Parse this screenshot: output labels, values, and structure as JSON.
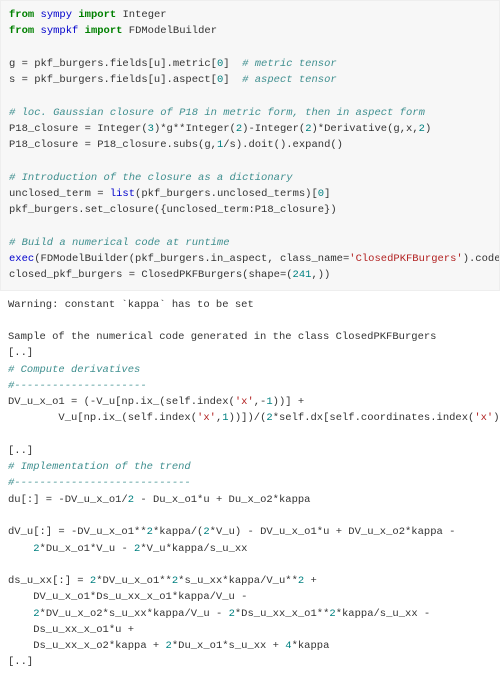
{
  "code": {
    "l01a": "from",
    "l01b": "sympy",
    "l01c": "import",
    "l01d": "Integer",
    "l02a": "from",
    "l02b": "sympkf",
    "l02c": "import",
    "l02d": "FDModelBuilder",
    "l03": "",
    "l04a": "g = pkf_burgers.fields[u].metric[",
    "l04n": "0",
    "l04b": "]  ",
    "l04c": "# metric tensor",
    "l05a": "s = pkf_burgers.fields[u].aspect[",
    "l05n": "0",
    "l05b": "]  ",
    "l05c": "# aspect tensor",
    "l06": "",
    "l07": "# loc. Gaussian closure of P18 in metric form, then in aspect form",
    "l08a": "P18_closure = Integer(",
    "l08n1": "3",
    "l08b": ")*g**Integer(",
    "l08n2": "2",
    "l08c": ")-Integer(",
    "l08n3": "2",
    "l08d": ")*Derivative(g,x,",
    "l08n4": "2",
    "l08e": ")",
    "l09a": "P18_closure = P18_closure.subs(g,",
    "l09n": "1",
    "l09b": "/s).doit().expand()",
    "l10": "",
    "l11": "# Introduction of the closure as a dictionary",
    "l12a": "unclosed_term = ",
    "l12b": "list",
    "l12c": "(pkf_burgers.unclosed_terms)[",
    "l12n": "0",
    "l12d": "]",
    "l13": "pkf_burgers.set_closure({unclosed_term:P18_closure})",
    "l14": "",
    "l15": "# Build a numerical code at runtime",
    "l16a": "exec",
    "l16b": "(FDModelBuilder(pkf_burgers.in_aspect, class_name=",
    "l16s": "'ClosedPKFBurgers'",
    "l16c": ").code)",
    "l17a": "closed_pkf_burgers = ClosedPKFBurgers(shape=(",
    "l17n": "241",
    "l17b": ",))"
  },
  "out": {
    "o01": "Warning: constant `kappa` has to be set",
    "o02": "",
    "o03": "Sample of the numerical code generated in the class ClosedPKFBurgers",
    "o04": "[..]",
    "o05": "# Compute derivatives",
    "o06": "#---------------------",
    "o07a": "DV_u_x_o1 = (-V_u[np.ix_(self.index(",
    "o07s1": "'x'",
    "o07b": ",-",
    "o07n1": "1",
    "o07c": "))] +",
    "o08a": "        V_u[np.ix_(self.index(",
    "o08s": "'x'",
    "o08b": ",",
    "o08n1": "1",
    "o08c": "))])/(",
    "o08n2": "2",
    "o08d": "*self.dx[self.coordinates.index(",
    "o08s2": "'x'",
    "o08e": ")])",
    "o09": "",
    "o10": "[..]",
    "o11": "# Implementation of the trend",
    "o12": "#----------------------------",
    "o13a": "du[:] = -DV_u_x_o1/",
    "o13n": "2",
    "o13b": " - Du_x_o1*u + Du_x_o2*kappa",
    "o14": "",
    "o15a": "dV_u[:] = -DV_u_x_o1**",
    "o15n1": "2",
    "o15b": "*kappa/(",
    "o15n2": "2",
    "o15c": "*V_u) - DV_u_x_o1*u + DV_u_x_o2*kappa -",
    "o16a": "    ",
    "o16n1": "2",
    "o16b": "*Du_x_o1*V_u - ",
    "o16n2": "2",
    "o16c": "*V_u*kappa/s_u_xx",
    "o17": "",
    "o18a": "ds_u_xx[:] = ",
    "o18n1": "2",
    "o18b": "*DV_u_x_o1**",
    "o18n2": "2",
    "o18c": "*s_u_xx*kappa/V_u**",
    "o18n3": "2",
    "o18d": " +",
    "o19a": "    DV_u_x_o1*Ds_u_xx_x_o1*kappa/V_u -",
    "o20a": "    ",
    "o20n1": "2",
    "o20b": "*DV_u_x_o2*s_u_xx*kappa/V_u - ",
    "o20n2": "2",
    "o20c": "*Ds_u_xx_x_o1**",
    "o20n3": "2",
    "o20d": "*kappa/s_u_xx -",
    "o21a": "    Ds_u_xx_x_o1*u +",
    "o22a": "    Ds_u_xx_x_o2*kappa + ",
    "o22n1": "2",
    "o22b": "*Du_x_o1*s_u_xx + ",
    "o22n2": "4",
    "o22c": "*kappa",
    "o23": "[..]"
  }
}
